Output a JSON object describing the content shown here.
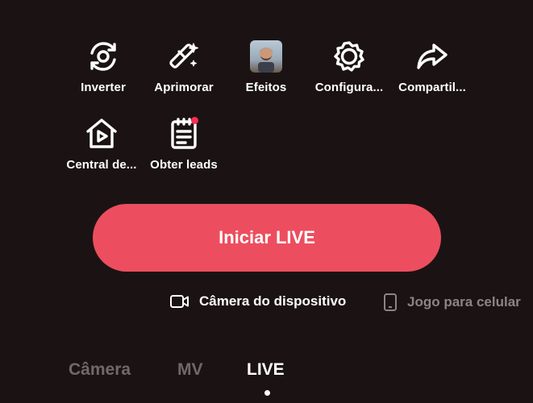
{
  "tools": [
    {
      "name": "flip",
      "label": "Inverter",
      "icon": "flip-camera-icon"
    },
    {
      "name": "enhance",
      "label": "Aprimorar",
      "icon": "magic-wand-icon"
    },
    {
      "name": "effects",
      "label": "Efeitos",
      "icon": "effects-avatar-thumbnail"
    },
    {
      "name": "settings",
      "label": "Configura...",
      "icon": "gear-icon"
    },
    {
      "name": "share",
      "label": "Compartil...",
      "icon": "share-arrow-icon"
    },
    {
      "name": "center",
      "label": "Central de...",
      "icon": "live-center-icon"
    },
    {
      "name": "leads",
      "label": "Obter leads",
      "icon": "clipboard-icon",
      "badge": true
    }
  ],
  "primary_button": {
    "label": "Iniciar LIVE",
    "color": "#ec4e5f"
  },
  "sources": [
    {
      "label": "Câmera do dispositivo",
      "icon": "camera-icon",
      "selected": true
    },
    {
      "label": "Jogo para celular",
      "icon": "phone-icon",
      "selected": false
    }
  ],
  "modes": [
    {
      "label": "Câmera",
      "active": false
    },
    {
      "label": "MV",
      "active": false
    },
    {
      "label": "LIVE",
      "active": true
    }
  ]
}
